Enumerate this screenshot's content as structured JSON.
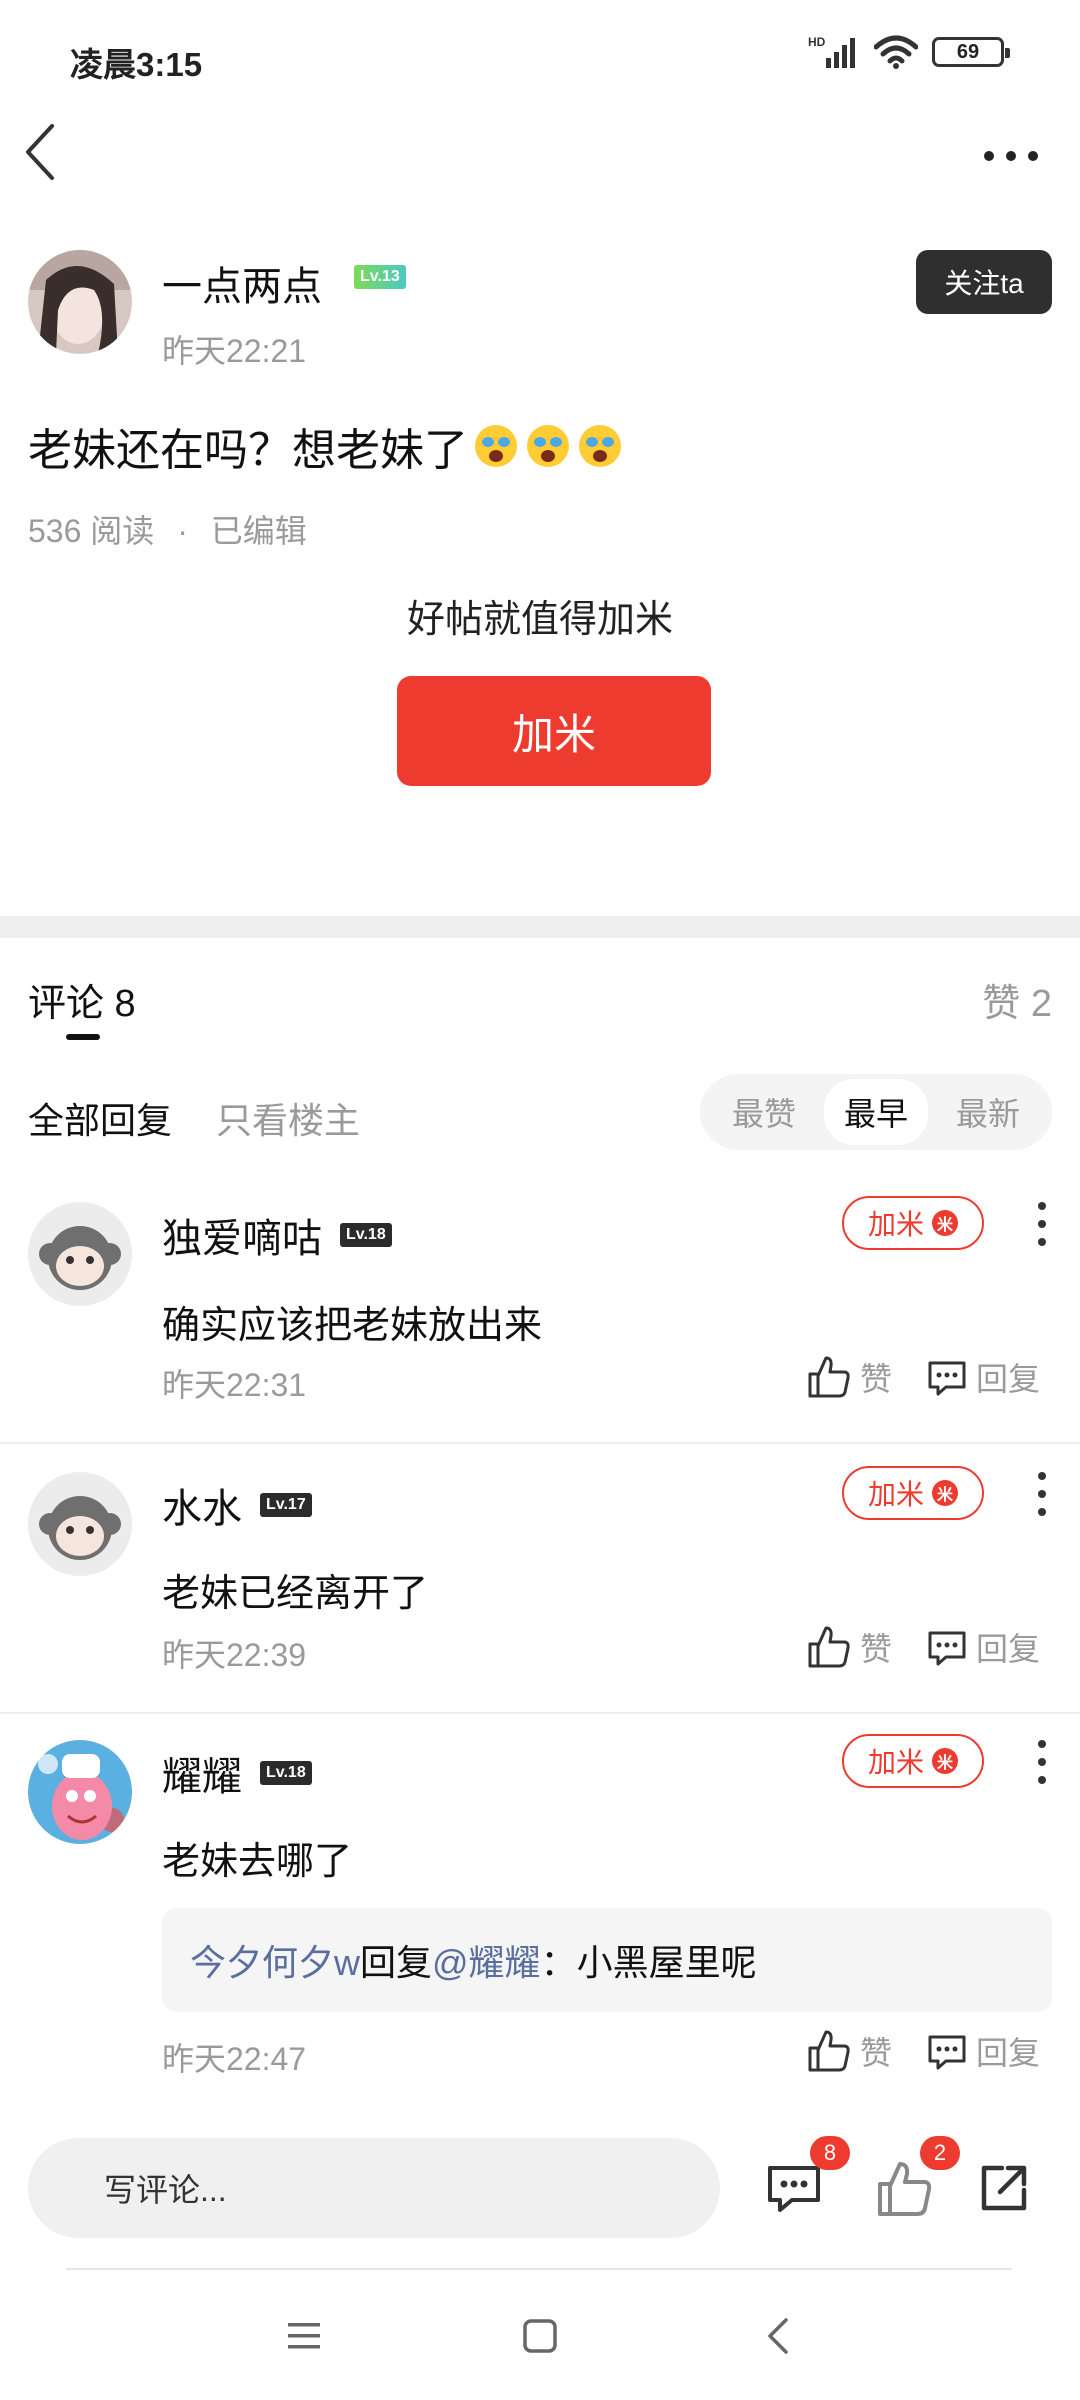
{
  "status_bar": {
    "time": "凌晨3:15",
    "network": "HD",
    "battery": "69"
  },
  "post": {
    "author": {
      "name": "一点两点",
      "level": "Lv.13",
      "time": "昨天22:21"
    },
    "follow_label": "关注ta",
    "title": "老妹还在吗？想老妹了",
    "reads": "536 阅读",
    "meta_sep": "·",
    "edited": "已编辑",
    "reward_prompt": "好帖就值得加米",
    "reward_button": "加米"
  },
  "comments_header": {
    "title": "评论 8",
    "likes": "赞 2",
    "filters": [
      "全部回复",
      "只看楼主"
    ],
    "sort": [
      "最赞",
      "最早",
      "最新"
    ],
    "sort_active": "最早"
  },
  "comments": [
    {
      "name": "独爱嘀咕",
      "level": "Lv.18",
      "text": "确实应该把老妹放出来",
      "time": "昨天22:31",
      "jiami": "加米",
      "like": "赞",
      "reply": "回复"
    },
    {
      "name": "水水",
      "level": "Lv.17",
      "text": "老妹已经离开了",
      "time": "昨天22:39",
      "jiami": "加米",
      "like": "赞",
      "reply": "回复"
    },
    {
      "name": "耀耀",
      "level": "Lv.18",
      "text": "老妹去哪了",
      "time": "昨天22:47",
      "jiami": "加米",
      "like": "赞",
      "reply": "回复",
      "sub_reply": {
        "user": "今夕何夕w",
        "verb": "回复",
        "target": "@耀耀",
        "text": "：小黑屋里呢"
      }
    }
  ],
  "bottom_bar": {
    "placeholder": "写评论...",
    "comment_count": "8",
    "like_count": "2"
  },
  "colors": {
    "accent": "#ee3b2f",
    "link": "#5a6fa0",
    "muted": "#9a9a9a"
  }
}
